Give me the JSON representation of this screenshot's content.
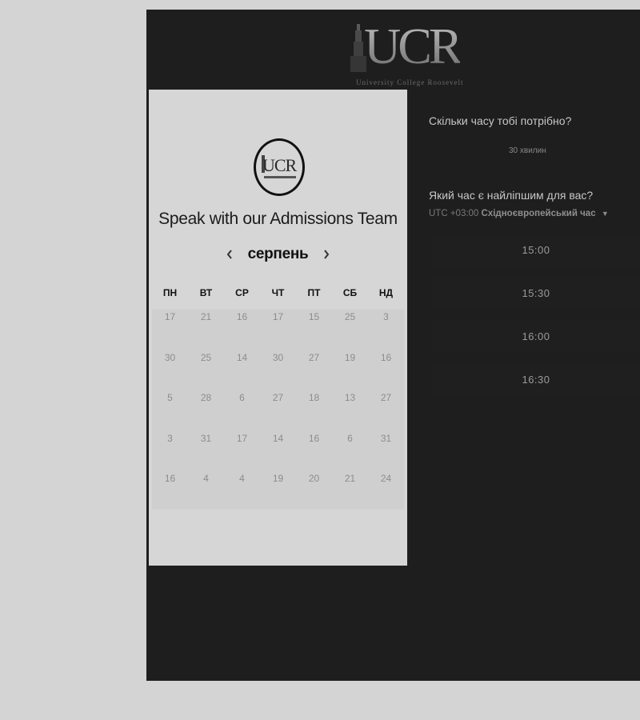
{
  "header": {
    "logo_text": "UCR",
    "logo_tagline": "University College Roosevelt"
  },
  "left": {
    "badge_text": "UCR",
    "title": "Speak with our Admissions Team",
    "month": "серпень",
    "weekdays": [
      "ПН",
      "ВТ",
      "СР",
      "ЧТ",
      "ПТ",
      "СБ",
      "НД"
    ],
    "days": [
      [
        "17",
        "21",
        "16",
        "17",
        "15",
        "25",
        "3"
      ],
      [
        "30",
        "25",
        "14",
        "30",
        "27",
        "19",
        "16"
      ],
      [
        "5",
        "28",
        "6",
        "27",
        "18",
        "13",
        "27"
      ],
      [
        "3",
        "31",
        "17",
        "14",
        "16",
        "6",
        "31"
      ],
      [
        "16",
        "4",
        "4",
        "19",
        "20",
        "21",
        "24"
      ]
    ]
  },
  "right": {
    "question_duration": "Скільки часу тобі потрібно?",
    "duration_value": "30 хвилин",
    "question_time": "Який час є найліпшим для вас?",
    "timezone_offset": "UTC +03:00",
    "timezone_name": "Східноєвропейський час",
    "slots": [
      "15:00",
      "15:30",
      "16:00",
      "16:30"
    ]
  }
}
